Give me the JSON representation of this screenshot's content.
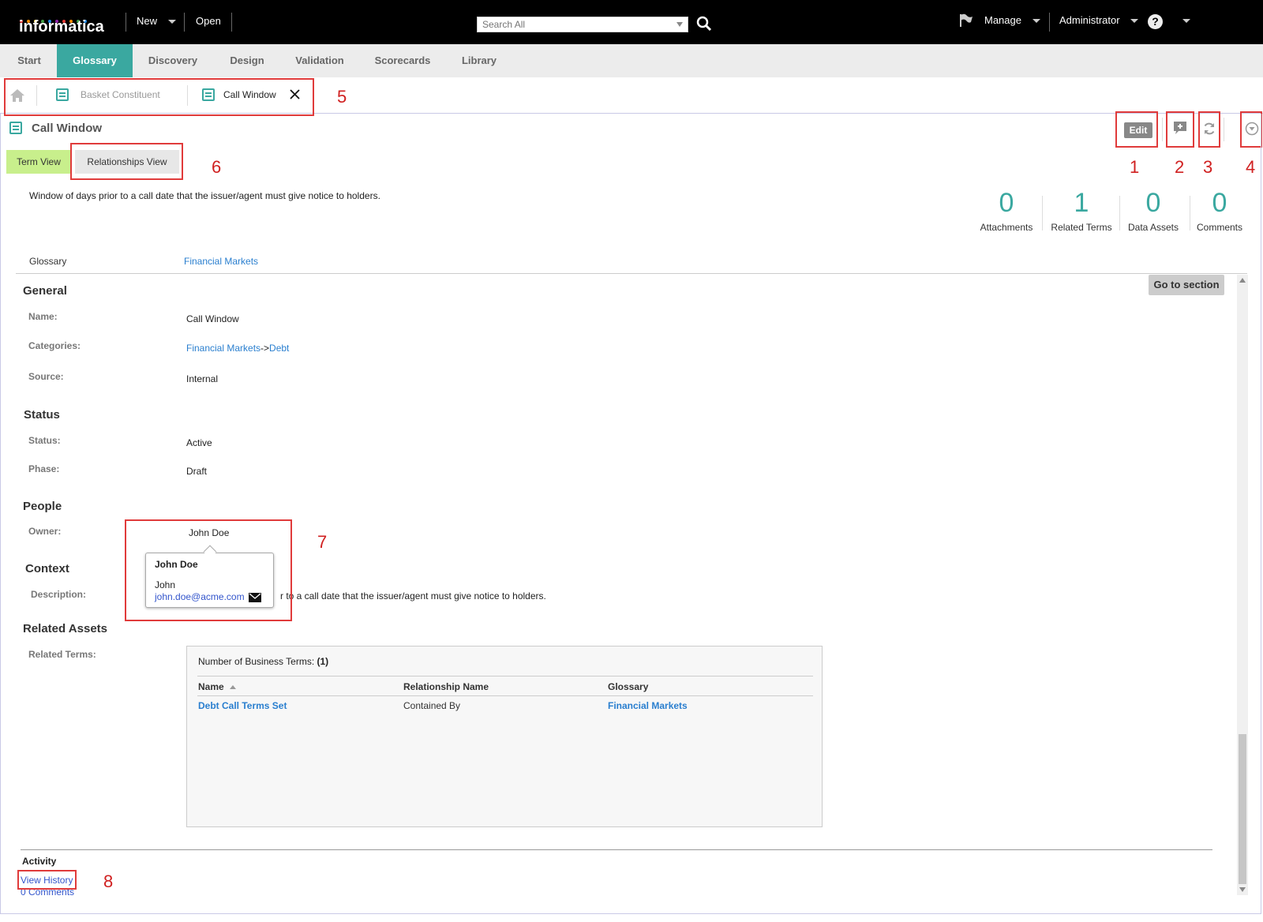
{
  "header": {
    "logo": "informatica",
    "new_label": "New",
    "open_label": "Open",
    "search_placeholder": "Search All",
    "manage_label": "Manage",
    "admin_label": "Administrator"
  },
  "nav": {
    "tabs": [
      "Start",
      "Glossary",
      "Discovery",
      "Design",
      "Validation",
      "Scorecards",
      "Library"
    ],
    "active": "Glossary"
  },
  "breadcrumb": {
    "items": [
      "Basket Constituent",
      "Call Window"
    ]
  },
  "page": {
    "title": "Call Window",
    "edit_label": "Edit",
    "view_tabs": [
      "Term View",
      "Relationships View"
    ],
    "description": "Window of days prior to a call date that the issuer/agent must give notice to holders.",
    "stats": [
      {
        "value": "0",
        "label": "Attachments"
      },
      {
        "value": "1",
        "label": "Related Terms"
      },
      {
        "value": "0",
        "label": "Data Assets"
      },
      {
        "value": "0",
        "label": "Comments"
      }
    ],
    "glossary_label": "Glossary",
    "glossary_value": "Financial Markets",
    "go_to_section": "Go to section"
  },
  "general": {
    "heading": "General",
    "name_label": "Name:",
    "name_value": "Call Window",
    "categories_label": "Categories:",
    "category_1": "Financial Markets",
    "category_sep": "->",
    "category_2": "Debt",
    "source_label": "Source:",
    "source_value": "Internal"
  },
  "status": {
    "heading": "Status",
    "status_label": "Status:",
    "status_value": "Active",
    "phase_label": "Phase:",
    "phase_value": "Draft"
  },
  "people": {
    "heading": "People",
    "owner_label": "Owner:",
    "owner_value": "John Doe",
    "popup_name": "John Doe",
    "popup_first": "John",
    "popup_email": "john.doe@acme.com"
  },
  "context": {
    "heading": "Context",
    "description_label": "Description:",
    "description_visible": "r to a call date that the issuer/agent must give notice to holders."
  },
  "related_assets": {
    "heading": "Related Assets",
    "related_terms_label": "Related Terms:",
    "count_label": "Number of Business Terms:",
    "count_value": "(1)",
    "columns": [
      "Name",
      "Relationship Name",
      "Glossary"
    ],
    "rows": [
      {
        "name": "Debt Call Terms Set",
        "relationship": "Contained By",
        "glossary": "Financial Markets"
      }
    ]
  },
  "activity": {
    "heading": "Activity",
    "view_history": "View History",
    "comments": "0 Comments"
  },
  "annotations": [
    "1",
    "2",
    "3",
    "4",
    "5",
    "6",
    "7",
    "8"
  ],
  "colors": {
    "accent": "#3aa8a0",
    "annotation": "#e03b3b",
    "term_view_tab": "#c8ef8c",
    "link": "#2a7fcf"
  }
}
